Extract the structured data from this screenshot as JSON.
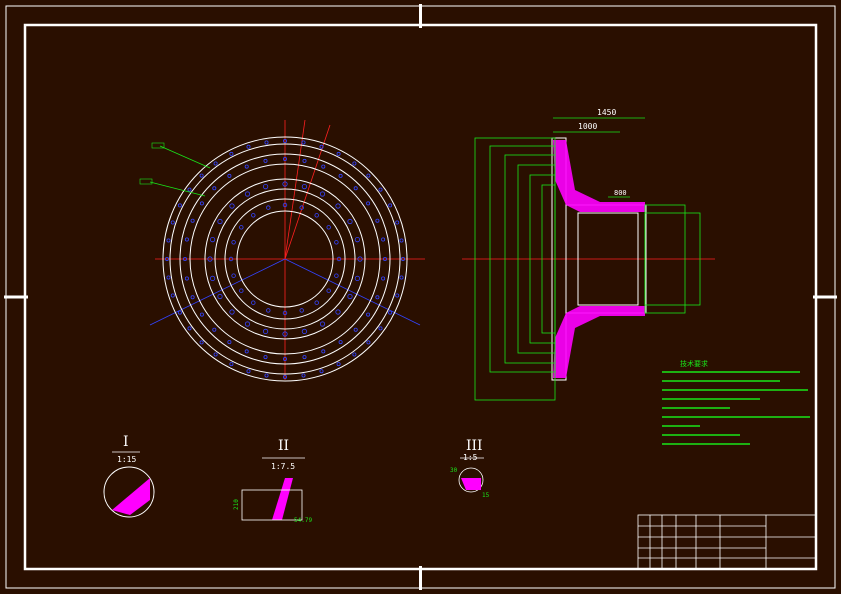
{
  "colors": {
    "background": "#2a0f00",
    "frame": "#ffffff",
    "dimension": "#19e619",
    "centerline": "#ff2020",
    "section_fill": "#ff00ff",
    "outline": "#ffffff",
    "hole": "#3344ff"
  },
  "overall_length": "1450",
  "hub_length": "1000",
  "bore_length": "800",
  "detail_labels": {
    "d1": "I",
    "d1_scale": "1:15",
    "d2": "II",
    "d2_scale": "1:7.5",
    "d3": "III",
    "d3_scale": "1:5"
  },
  "detail_dims": {
    "d2_a": "210",
    "d2_b": "54.79",
    "d3_a": "30",
    "d3_b": "15"
  },
  "notes_title": "技术要求"
}
